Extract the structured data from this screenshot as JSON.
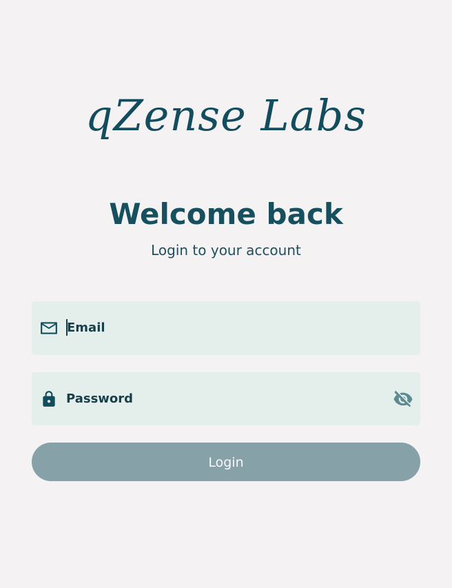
{
  "brand": {
    "logo_text": "qZense Labs"
  },
  "header": {
    "title": "Welcome back",
    "subtitle": "Login to your account"
  },
  "form": {
    "email_label": "Email",
    "password_label": "Password",
    "login_label": "Login"
  },
  "icons": {
    "email": "mail-icon",
    "password": "lock-icon",
    "visibility": "eye-off-icon"
  },
  "colors": {
    "background": "#f5f2f4",
    "brand": "#134d5d",
    "field_background": "#e4efeb",
    "button_disabled": "#87a1a8"
  }
}
